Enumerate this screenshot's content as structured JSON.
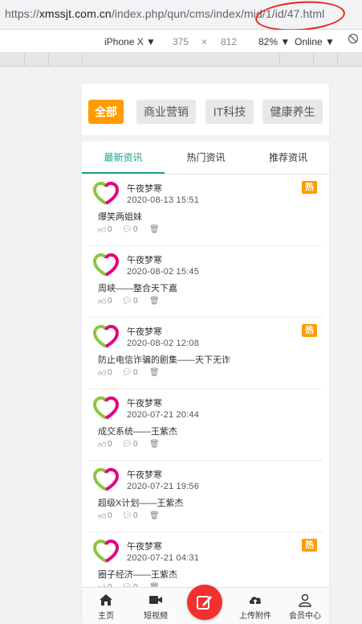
{
  "browser": {
    "url_scheme": "https://",
    "url_domain": "xmssjt.com.cn",
    "url_path": "/index.php/qun/cms/index/mid/1/id/47.html"
  },
  "devtools": {
    "device": "iPhone X ▼",
    "width": "375",
    "times": "×",
    "height": "812",
    "zoom": "82% ▼",
    "network": "Online ▼"
  },
  "categories": [
    {
      "label": "全部",
      "active": true
    },
    {
      "label": "商业营销",
      "active": false
    },
    {
      "label": "IT科技",
      "active": false
    },
    {
      "label": "健康养生",
      "active": false
    }
  ],
  "tabs": [
    {
      "label": "最新资讯",
      "active": true
    },
    {
      "label": "热门资讯",
      "active": false
    },
    {
      "label": "推荐资讯",
      "active": false
    }
  ],
  "articles": [
    {
      "author": "午夜梦寒",
      "time": "2020-08-13 15:51",
      "title": "爆笑两姐妹",
      "likes": "0",
      "comments": "0",
      "hot": true
    },
    {
      "author": "午夜梦寒",
      "time": "2020-08-02 15:45",
      "title": "周峡——整合天下嘉",
      "likes": "0",
      "comments": "0",
      "hot": false
    },
    {
      "author": "午夜梦寒",
      "time": "2020-08-02 12:08",
      "title": "防止电信诈骗的剧集——天下无诈",
      "likes": "0",
      "comments": "0",
      "hot": true
    },
    {
      "author": "午夜梦寒",
      "time": "2020-07-21 20:44",
      "title": "成交系统——王紫杰",
      "likes": "0",
      "comments": "0",
      "hot": false
    },
    {
      "author": "午夜梦寒",
      "time": "2020-07-21 19:56",
      "title": "超级X计划——王紫杰",
      "likes": "0",
      "comments": "0",
      "hot": false
    },
    {
      "author": "午夜梦寒",
      "time": "2020-07-21 04:31",
      "title": "圈子经济——王紫杰",
      "likes": "0",
      "comments": "0",
      "hot": true
    }
  ],
  "hot_label": "热",
  "nav": {
    "home": "主页",
    "video": "短视频",
    "upload": "上传附件",
    "member": "会员中心"
  },
  "colors": {
    "accent": "#ff9c00",
    "tab_active": "#1aa187",
    "post_button": "#f23030",
    "annotation_circle": "#e8261d"
  }
}
